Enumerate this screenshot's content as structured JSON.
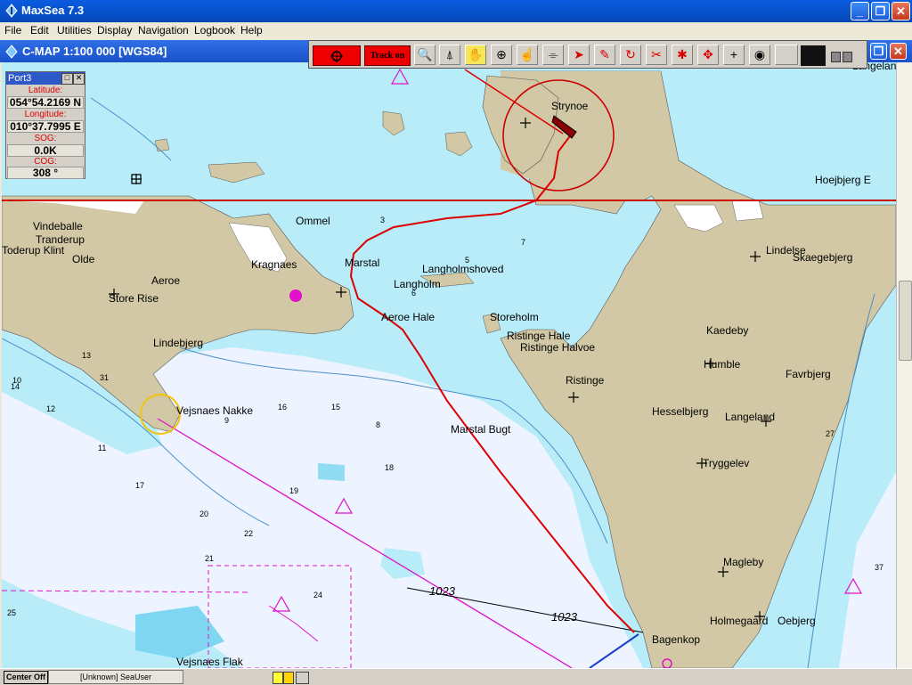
{
  "app": {
    "title": "MaxSea 7.3"
  },
  "menu": [
    "File",
    "Edit",
    "Utilities",
    "Display",
    "Navigation",
    "Logbook",
    "Help"
  ],
  "chart_window": {
    "title": "C-MAP  1:100 000 [WGS84]"
  },
  "toolbar": {
    "track_label": "Track on"
  },
  "info_panel": {
    "title": "Port3",
    "latitude_label": "Latitude:",
    "latitude": "054°54.2169 N",
    "longitude_label": "Longitude:",
    "longitude": "010°37.7995 E",
    "sog_label": "SOG:",
    "sog": "0.0K",
    "cog_label": "COG:",
    "cog": "308 °"
  },
  "map": {
    "place_names": [
      "Strynoe",
      "Hoejbjerg E",
      "Langeland",
      "Vindeballe",
      "Tranderup",
      "Toderup Klint",
      "Olde",
      "Ommel",
      "Kragnaes",
      "Marstal",
      "Langholmshoved",
      "Langholm",
      "Aeroe Hale",
      "Storeholm",
      "Ristinge Hale",
      "Ristinge Halvoe",
      "Ristinge",
      "Aeroe",
      "Store Rise",
      "Lindebjerg",
      "Vejsnaes Nakke",
      "Marstal Bugt",
      "Lindelse",
      "Skaegebjerg",
      "Kaedeby",
      "Humble",
      "Favrbjerg",
      "Hesselbjerg",
      "Langeland",
      "Tryggelev",
      "Magleby",
      "Holmegaard",
      "Oebjerg",
      "Bagenkop",
      "Vejsnaes Flak"
    ],
    "depth_labels": [
      "10",
      "12",
      "14",
      "13",
      "11",
      "16",
      "15",
      "17",
      "18",
      "19",
      "20",
      "21",
      "22",
      "24",
      "25",
      "8",
      "9",
      "6",
      "5",
      "3",
      "7",
      "27",
      "37",
      "31"
    ],
    "route_labels": [
      "1023",
      "1023"
    ]
  },
  "status": {
    "center_label": "Center Off",
    "user_label": "[Unknown] SeaUser"
  },
  "colors": {
    "land": "#d2c8a5",
    "shallow": "#b7ecf8",
    "deep": "#eef4ff",
    "track": "#dd0000",
    "route": "#e011c8"
  }
}
